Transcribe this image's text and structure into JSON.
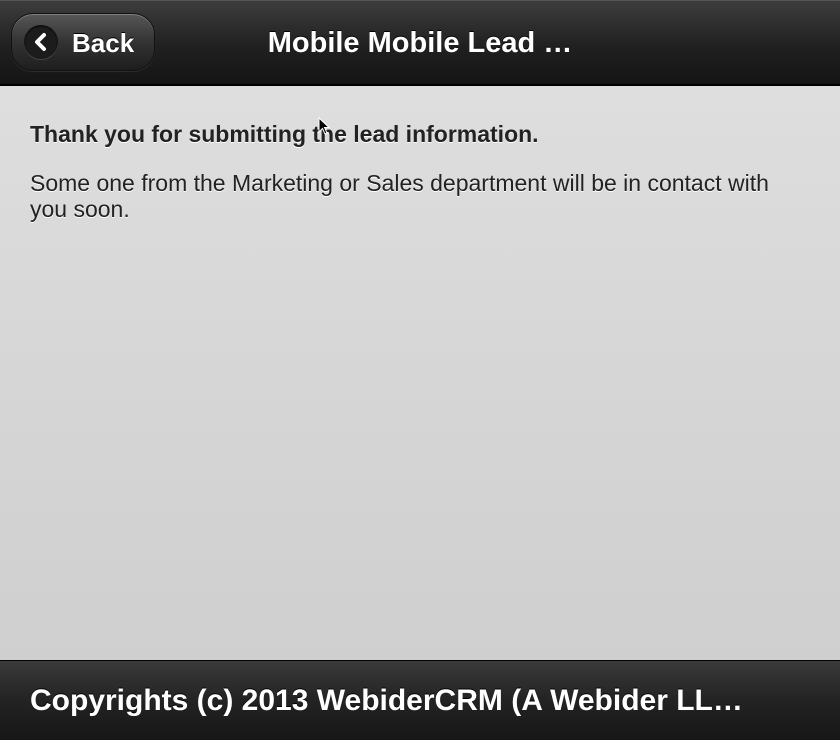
{
  "header": {
    "back_label": "Back",
    "title": "Mobile Mobile Lead …"
  },
  "content": {
    "heading": "Thank you for submitting the lead information.",
    "message": "Some one from the Marketing or Sales department will be in contact with you soon."
  },
  "footer": {
    "text": "Copyrights (c) 2013 WebiderCRM (A Webider LL…"
  },
  "icons": {
    "back": "chevron-left-icon",
    "cursor": "mouse-pointer-icon"
  },
  "colors": {
    "header_bg": "#202020",
    "content_bg": "#d6d6d6",
    "text": "#222222",
    "header_text": "#ffffff"
  }
}
